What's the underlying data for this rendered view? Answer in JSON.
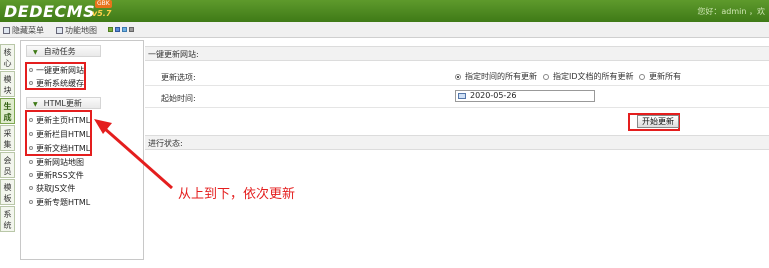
{
  "header": {
    "logo": "DEDECMS",
    "version": "v5.7",
    "badge": "GBK",
    "greeting": "您好：admin ，欢"
  },
  "toolbar": {
    "hide_menu": "隐藏菜单",
    "site_map": "功能地图"
  },
  "tabs": [
    "核心",
    "模块",
    "生成",
    "采集",
    "会员",
    "模板",
    "系统"
  ],
  "menu": {
    "auto_task": {
      "title": "自动任务",
      "items": [
        "一键更新网站",
        "更新系统缓存"
      ]
    },
    "html_update": {
      "title": "HTML更新",
      "items": [
        "更新主页HTML",
        "更新栏目HTML",
        "更新文档HTML",
        "更新网站地图",
        "更新RSS文件",
        "获取JS文件",
        "更新专题HTML"
      ]
    }
  },
  "main": {
    "panel_title": "一键更新网站:",
    "update_label": "更新选项:",
    "options": [
      "指定时间的所有更新",
      "指定ID文档的所有更新",
      "更新所有"
    ],
    "selected_option": 0,
    "start_time_label": "起始时间:",
    "start_time_value": "2020-05-26",
    "start_button": "开始更新",
    "status_label": "进行状态:"
  },
  "annotation": {
    "text": "从上到下，依次更新",
    "color": "#e41e1e"
  },
  "colors": {
    "header_green": "#3f7a17",
    "annotation_red": "#e41e1e"
  }
}
